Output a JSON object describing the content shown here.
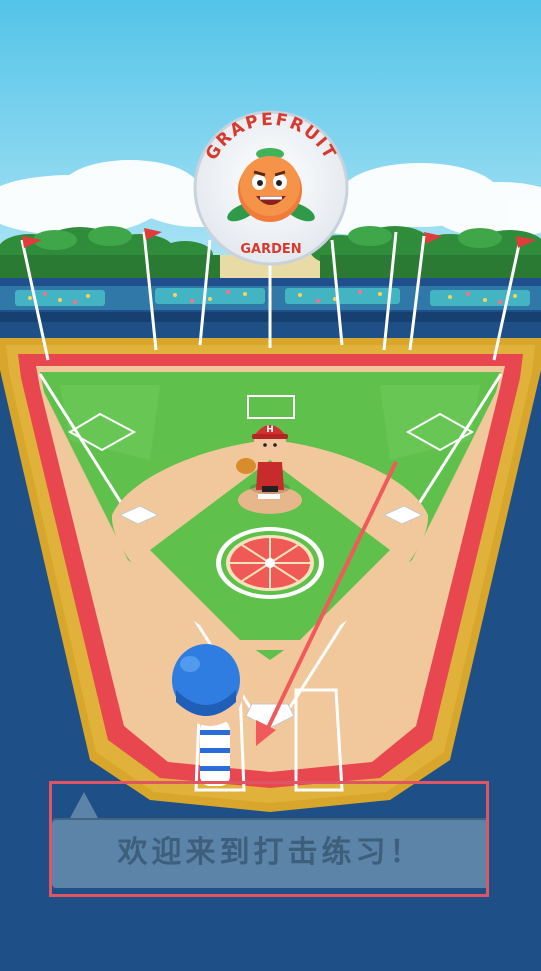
{
  "sign": {
    "top_text": "GRAPEFRUIT",
    "bottom_text": "GARDEN"
  },
  "players": {
    "pitcher_cap_letter": "H"
  },
  "tutorial": {
    "message": "欢迎来到打击练习！"
  },
  "colors": {
    "sky": "#8ed6f5",
    "grass": "#5fc04b",
    "infield_dirt": "#f1c89c",
    "foul_track": "#e8474f",
    "wall": "#d9a62c",
    "backdrop": "#1e4f86",
    "aim_arrow": "#f05a5a",
    "tutorial_box": "#5b84a8",
    "highlight": "#e05564"
  },
  "icons": {
    "pitcher": "pitcher-character-icon",
    "batter": "batter-character-icon",
    "mascot": "grapefruit-mascot-icon",
    "home_plate": "home-plate-icon",
    "pennant": "pennant-flag-icon"
  }
}
